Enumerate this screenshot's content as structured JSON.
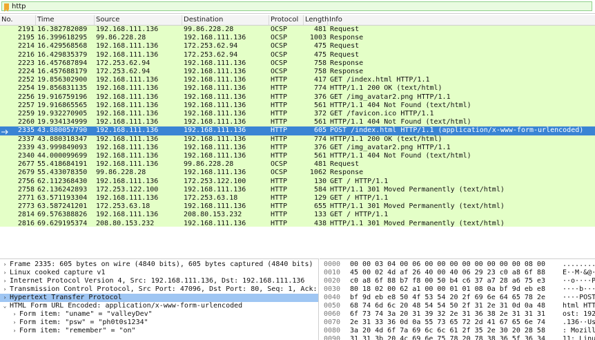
{
  "filter": {
    "value": "http"
  },
  "columns": [
    "No.",
    "Time",
    "Source",
    "Destination",
    "Protocol",
    "Length",
    "Info"
  ],
  "packets": [
    {
      "no": "2191",
      "time": "16.382782089",
      "src": "192.168.111.136",
      "dst": "99.86.228.28",
      "proto": "OCSP",
      "len": "481",
      "info": "Request"
    },
    {
      "no": "2195",
      "time": "16.399618295",
      "src": "99.86.228.28",
      "dst": "192.168.111.136",
      "proto": "OCSP",
      "len": "1003",
      "info": "Response"
    },
    {
      "no": "2214",
      "time": "16.429568568",
      "src": "192.168.111.136",
      "dst": "172.253.62.94",
      "proto": "OCSP",
      "len": "475",
      "info": "Request"
    },
    {
      "no": "2216",
      "time": "16.429835379",
      "src": "192.168.111.136",
      "dst": "172.253.62.94",
      "proto": "OCSP",
      "len": "475",
      "info": "Request"
    },
    {
      "no": "2223",
      "time": "16.457687894",
      "src": "172.253.62.94",
      "dst": "192.168.111.136",
      "proto": "OCSP",
      "len": "758",
      "info": "Response"
    },
    {
      "no": "2224",
      "time": "16.457688179",
      "src": "172.253.62.94",
      "dst": "192.168.111.136",
      "proto": "OCSP",
      "len": "758",
      "info": "Response"
    },
    {
      "no": "2252",
      "time": "19.856302900",
      "src": "192.168.111.136",
      "dst": "192.168.111.136",
      "proto": "HTTP",
      "len": "417",
      "info": "GET /index.html HTTP/1.1"
    },
    {
      "no": "2254",
      "time": "19.856831135",
      "src": "192.168.111.136",
      "dst": "192.168.111.136",
      "proto": "HTTP",
      "len": "774",
      "info": "HTTP/1.1 200 OK  (text/html)"
    },
    {
      "no": "2256",
      "time": "19.916759196",
      "src": "192.168.111.136",
      "dst": "192.168.111.136",
      "proto": "HTTP",
      "len": "376",
      "info": "GET /img_avatar2.png HTTP/1.1"
    },
    {
      "no": "2257",
      "time": "19.916865565",
      "src": "192.168.111.136",
      "dst": "192.168.111.136",
      "proto": "HTTP",
      "len": "561",
      "info": "HTTP/1.1 404 Not Found  (text/html)"
    },
    {
      "no": "2259",
      "time": "19.932270905",
      "src": "192.168.111.136",
      "dst": "192.168.111.136",
      "proto": "HTTP",
      "len": "372",
      "info": "GET /favicon.ico HTTP/1.1"
    },
    {
      "no": "2260",
      "time": "19.934134999",
      "src": "192.168.111.136",
      "dst": "192.168.111.136",
      "proto": "HTTP",
      "len": "561",
      "info": "HTTP/1.1 404 Not Found  (text/html)"
    },
    {
      "no": "2335",
      "time": "43.880057790",
      "src": "192.168.111.136",
      "dst": "192.168.111.136",
      "proto": "HTTP",
      "len": "605",
      "info": "POST /index.html HTTP/1.1  (application/x-www-form-urlencoded)",
      "selected": true
    },
    {
      "no": "2337",
      "time": "43.880318347",
      "src": "192.168.111.136",
      "dst": "192.168.111.136",
      "proto": "HTTP",
      "len": "774",
      "info": "HTTP/1.1 200 OK  (text/html)"
    },
    {
      "no": "2339",
      "time": "43.999849093",
      "src": "192.168.111.136",
      "dst": "192.168.111.136",
      "proto": "HTTP",
      "len": "376",
      "info": "GET /img_avatar2.png HTTP/1.1"
    },
    {
      "no": "2340",
      "time": "44.000099699",
      "src": "192.168.111.136",
      "dst": "192.168.111.136",
      "proto": "HTTP",
      "len": "561",
      "info": "HTTP/1.1 404 Not Found  (text/html)"
    },
    {
      "no": "2677",
      "time": "55.418684191",
      "src": "192.168.111.136",
      "dst": "99.86.228.28",
      "proto": "OCSP",
      "len": "481",
      "info": "Request"
    },
    {
      "no": "2679",
      "time": "55.433078350",
      "src": "99.86.228.28",
      "dst": "192.168.111.136",
      "proto": "OCSP",
      "len": "1062",
      "info": "Response"
    },
    {
      "no": "2756",
      "time": "62.112368430",
      "src": "192.168.111.136",
      "dst": "172.253.122.100",
      "proto": "HTTP",
      "len": "130",
      "info": "GET / HTTP/1.1"
    },
    {
      "no": "2758",
      "time": "62.136242893",
      "src": "172.253.122.100",
      "dst": "192.168.111.136",
      "proto": "HTTP",
      "len": "584",
      "info": "HTTP/1.1 301 Moved Permanently  (text/html)"
    },
    {
      "no": "2771",
      "time": "63.571193304",
      "src": "192.168.111.136",
      "dst": "172.253.63.18",
      "proto": "HTTP",
      "len": "129",
      "info": "GET / HTTP/1.1"
    },
    {
      "no": "2773",
      "time": "63.587241201",
      "src": "172.253.63.18",
      "dst": "192.168.111.136",
      "proto": "HTTP",
      "len": "655",
      "info": "HTTP/1.1 301 Moved Permanently  (text/html)"
    },
    {
      "no": "2814",
      "time": "69.576388826",
      "src": "192.168.111.136",
      "dst": "208.80.153.232",
      "proto": "HTTP",
      "len": "133",
      "info": "GET / HTTP/1.1"
    },
    {
      "no": "2816",
      "time": "69.629195374",
      "src": "208.80.153.232",
      "dst": "192.168.111.136",
      "proto": "HTTP",
      "len": "438",
      "info": "HTTP/1.1 301 Moved Permanently  (text/html)"
    }
  ],
  "details": [
    {
      "text": "Frame 2335: 605 bytes on wire (4840 bits), 605 bytes captured (4840 bits)",
      "expander": "collapsed",
      "indent": 0
    },
    {
      "text": "Linux cooked capture v1",
      "expander": "collapsed",
      "indent": 0
    },
    {
      "text": "Internet Protocol Version 4, Src: 192.168.111.136, Dst: 192.168.111.136",
      "expander": "collapsed",
      "indent": 0
    },
    {
      "text": "Transmission Control Protocol, Src Port: 47096, Dst Port: 80, Seq: 1, Ack:",
      "expander": "collapsed",
      "indent": 0
    },
    {
      "text": "Hypertext Transfer Protocol",
      "expander": "collapsed",
      "indent": 0,
      "highlight": true
    },
    {
      "text": "HTML Form URL Encoded: application/x-www-form-urlencoded",
      "expander": "expanded",
      "indent": 0
    },
    {
      "text": "Form item: \"uname\" = \"valleyDev\"",
      "expander": "collapsed",
      "indent": 1
    },
    {
      "text": "Form item: \"psw\" = \"ph0t0s1234\"",
      "expander": "collapsed",
      "indent": 1
    },
    {
      "text": "Form item: \"remember\" = \"on\"",
      "expander": "collapsed",
      "indent": 1
    }
  ],
  "bytes": [
    {
      "off": "0000",
      "hex": "00 00 03 04 00 06 00 00  00 00 00 00 00 00 08 00",
      "ascii": "........"
    },
    {
      "off": "0010",
      "hex": "45 00 02 4d af 26 40 00  40 06 29 23 c0 a8 6f 88",
      "ascii": "E··M·&@·"
    },
    {
      "off": "0020",
      "hex": "c0 a8 6f 88 b7 f8 00 50  b4 c6 37 a7 28 a6 75 e3",
      "ascii": "··o····P"
    },
    {
      "off": "0030",
      "hex": "80 18 02 00 62 a1 00 00  01 01 08 0a bf 9d eb e8",
      "ascii": "····b···"
    },
    {
      "off": "0040",
      "hex": "bf 9d eb e8 50 4f 53 54  20 2f 69 6e 64 65 78 2e",
      "ascii": "····POST"
    },
    {
      "off": "0050",
      "hex": "68 74 6d 6c 20 48 54 54  50 2f 31 2e 31 0d 0a 48",
      "ascii": "html HTT"
    },
    {
      "off": "0060",
      "hex": "6f 73 74 3a 20 31 39 32  2e 31 36 38 2e 31 31 31",
      "ascii": "ost: 192"
    },
    {
      "off": "0070",
      "hex": "2e 31 33 36 0d 0a 55 73  65 72 2d 41 67 65 6e 74",
      "ascii": ".136··Us"
    },
    {
      "off": "0080",
      "hex": "3a 20 4d 6f 7a 69 6c 6c  61 2f 35 2e 30 20 28 58",
      "ascii": ": Mozill"
    },
    {
      "off": "0090",
      "hex": "31 31 3b 20 4c 69 6e 75  78 20 78 38 36 5f 36 34",
      "ascii": "11; Linu"
    }
  ]
}
